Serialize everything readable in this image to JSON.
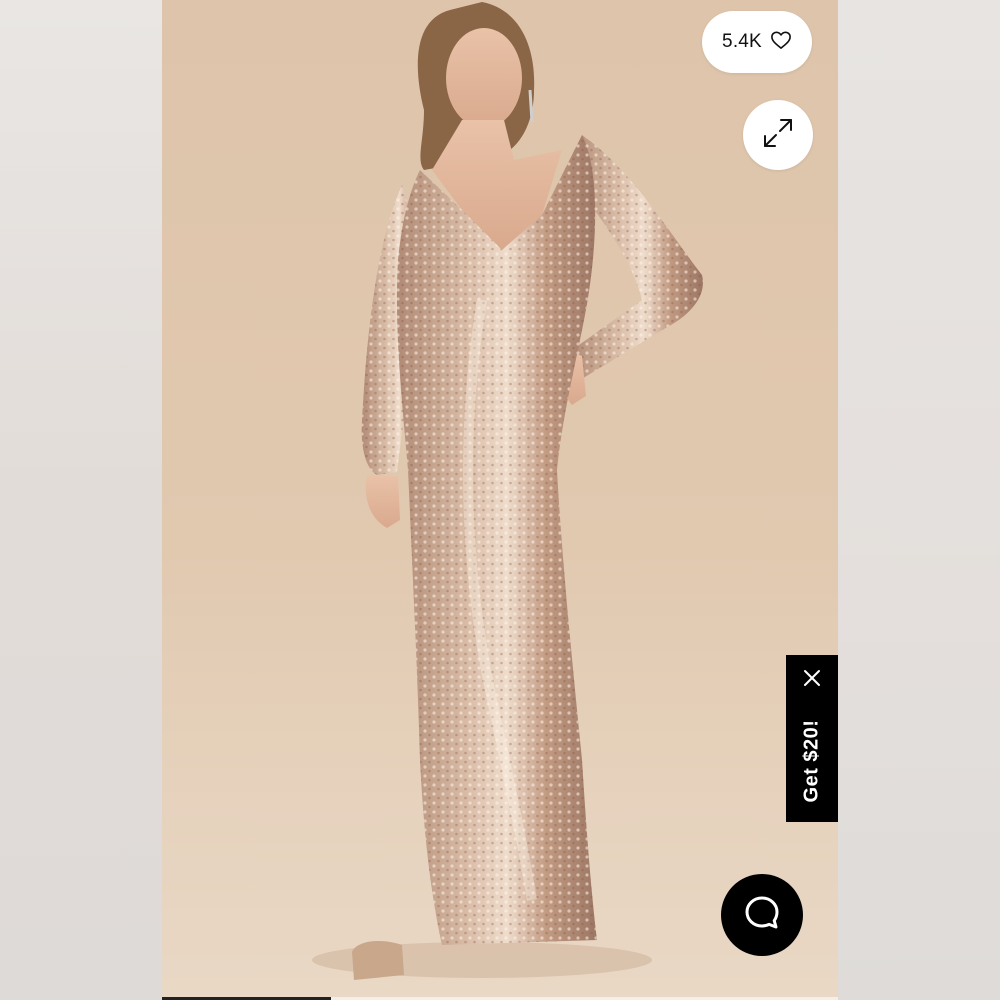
{
  "likes": {
    "count": "5.4K",
    "icon": "heart-outline-icon"
  },
  "expand": {
    "icon": "expand-arrows-icon"
  },
  "promo": {
    "label": "Get $20!",
    "close_icon": "close-icon"
  },
  "chat": {
    "icon": "chat-bubble-icon"
  },
  "carousel": {
    "progress": 0.25
  },
  "colors": {
    "photo_background": "#e1c9b0",
    "dress_sequin": "#c9a58c",
    "promo_background": "#000000",
    "chat_background": "#000000"
  }
}
